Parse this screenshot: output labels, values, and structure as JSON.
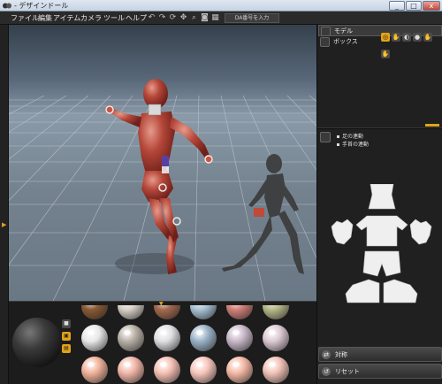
{
  "window": {
    "title": "- デザインドール",
    "controls": [
      "minimize-button",
      "maximize-button",
      "close-button"
    ]
  },
  "menubar": {
    "items": [
      "ファイル",
      "編集",
      "アイテム",
      "カメラ",
      "ツール",
      "ヘルプ"
    ],
    "toolbar_icons": [
      "undo-icon",
      "redo-icon",
      "rotate-icon",
      "move-icon",
      "zoom-icon",
      "camera-icon",
      "capture-icon",
      "grid-icon",
      "screen-icon"
    ],
    "da_input_placeholder": "DA番号を入力"
  },
  "scene_tree": {
    "items": [
      {
        "label": "モデル",
        "selected": true
      },
      {
        "label": "ボックス",
        "selected": false
      }
    ],
    "mode_icons": [
      "pose-mode-icon",
      "hand-icon",
      "foot-icon",
      "head-icon",
      "palm-icon",
      "pair-hands-icon"
    ]
  },
  "motion_panel": {
    "items": [
      "足の連動",
      "手首の連動"
    ]
  },
  "body_parts": [
    "torso",
    "shirt",
    "left-glove",
    "right-glove",
    "shorts",
    "shoes"
  ],
  "buttons": {
    "symmetry": "対称",
    "reset": "リセット"
  },
  "materials": {
    "rows": [
      [
        "#8a5a35",
        "#d8d2c8",
        "#a56a4e",
        "#a9c4d6",
        "#d4807a",
        "#b8ba8a"
      ],
      [
        "#e8e8e8",
        "#b8b0a6",
        "#e0e0e4",
        "#9ab2c6",
        "#c8b8c8",
        "#dccad2"
      ],
      [
        "#f0b29a",
        "#f2b6a8",
        "#f6c0b4",
        "#f8c6bc",
        "#f4b8a4",
        "#f0c2b6"
      ]
    ]
  },
  "colors": {
    "accent": "#e2a317",
    "figure": "#b5473a",
    "shadow_figure": "#3a3a3a"
  }
}
